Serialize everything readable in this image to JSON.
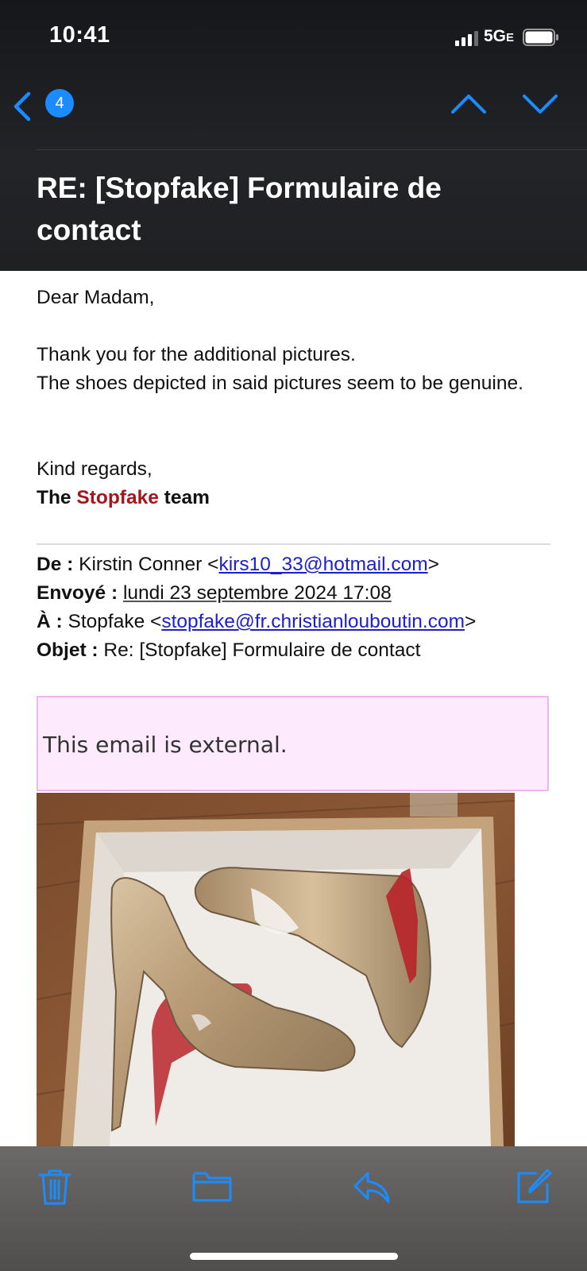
{
  "status_bar": {
    "time": "10:41",
    "network": "5G",
    "network_suffix": "E"
  },
  "nav": {
    "unread_count": "4"
  },
  "subject": "RE: [Stopfake] Formulaire de contact",
  "body": {
    "greeting": "Dear Madam,",
    "line1": "Thank you for the additional pictures.",
    "line2": "The shoes depicted in said pictures seem to be genuine.",
    "regards": "Kind regards,",
    "signature_pre": "The",
    "signature_brand": "Stopfake",
    "signature_post": "team"
  },
  "quoted_header": {
    "from_label": "De :",
    "from_name": "Kirstin Conner <",
    "from_email": "kirs10_33@hotmail.com",
    "from_close": ">",
    "sent_label": "Envoyé :",
    "sent_value": "lundi 23 septembre 2024 17:08",
    "to_label": "À :",
    "to_name": "Stopfake <",
    "to_email": "stopfake@fr.christianlouboutin.com",
    "to_close": ">",
    "subject_label": "Objet :",
    "subject_value": "Re: [Stopfake] Formulaire de contact"
  },
  "external_notice": "This email is external.",
  "toolbar": {
    "icons": [
      "trash-icon",
      "folder-icon",
      "reply-icon",
      "compose-icon"
    ]
  },
  "colors": {
    "accent": "#1a8cff",
    "brand": "#a5161c",
    "link": "#1b1fcc",
    "banner_bg": "#fdeafd"
  }
}
